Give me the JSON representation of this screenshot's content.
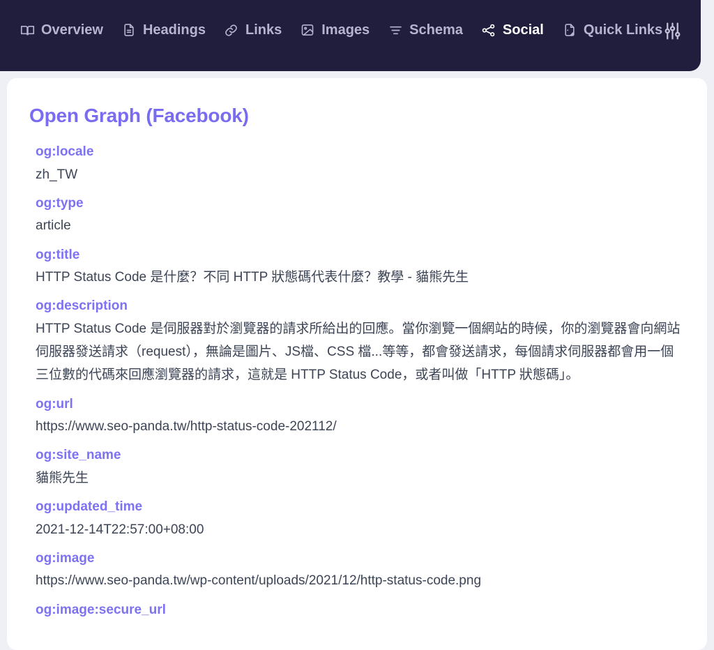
{
  "nav": {
    "items": [
      {
        "label": "Overview",
        "icon": "book-icon",
        "active": false
      },
      {
        "label": "Headings",
        "icon": "document-icon",
        "active": false
      },
      {
        "label": "Links",
        "icon": "link-icon",
        "active": false
      },
      {
        "label": "Images",
        "icon": "image-icon",
        "active": false
      },
      {
        "label": "Schema",
        "icon": "list-icon",
        "active": false
      },
      {
        "label": "Social",
        "icon": "share-icon",
        "active": true
      },
      {
        "label": "Quick Links",
        "icon": "quick-links-icon",
        "active": false
      }
    ],
    "settings_icon": "sliders-icon"
  },
  "main": {
    "section_title": "Open Graph (Facebook)",
    "properties": [
      {
        "key": "og:locale",
        "value": "zh_TW"
      },
      {
        "key": "og:type",
        "value": "article"
      },
      {
        "key": "og:title",
        "value": "HTTP Status Code 是什麼？不同 HTTP 狀態碼代表什麼？教學 - 貓熊先生"
      },
      {
        "key": "og:description",
        "value": "HTTP Status Code 是伺服器對於瀏覽器的請求所給出的回應。當你瀏覽一個網站的時候，你的瀏覽器會向網站伺服器發送請求（request），無論是圖片、JS檔、CSS 檔...等等，都會發送請求，每個請求伺服器都會用一個三位數的代碼來回應瀏覽器的請求，這就是 HTTP Status Code，或者叫做「HTTP 狀態碼」。"
      },
      {
        "key": "og:url",
        "value": "https://www.seo-panda.tw/http-status-code-202112/"
      },
      {
        "key": "og:site_name",
        "value": "貓熊先生"
      },
      {
        "key": "og:updated_time",
        "value": "2021-12-14T22:57:00+08:00"
      },
      {
        "key": "og:image",
        "value": "https://www.seo-panda.tw/wp-content/uploads/2021/12/http-status-code.png"
      },
      {
        "key": "og:image:secure_url",
        "value": ""
      }
    ]
  },
  "colors": {
    "navbar_bg": "#211d3d",
    "nav_inactive": "#b7b4cf",
    "nav_active": "#ffffff",
    "accent": "#7d72f2",
    "value_text": "#3c4455",
    "page_bg": "#eef0f6",
    "card_bg": "#ffffff"
  }
}
